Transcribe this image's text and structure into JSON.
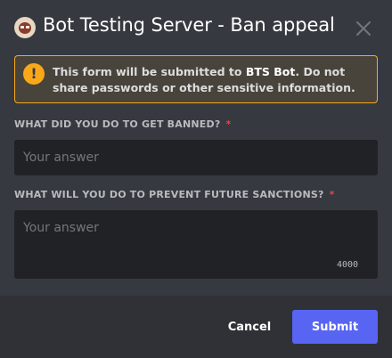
{
  "header": {
    "server_icon": "server-avatar",
    "title": "Bot Testing Server - Ban appeal",
    "close_icon": "close-icon"
  },
  "warning": {
    "icon": "warning-icon",
    "icon_glyph": "!",
    "text_before": "This form will be submitted to ",
    "bot_name": "BTS Bot",
    "text_after": ". Do not share passwords or other sensitive information."
  },
  "questions": [
    {
      "label": "WHAT DID YOU DO TO GET BANNED?",
      "required_mark": "*",
      "placeholder": "Your answer"
    },
    {
      "label": "WHAT WILL YOU DO TO PREVENT FUTURE SANCTIONS?",
      "required_mark": "*",
      "placeholder": "Your answer",
      "char_limit": "4000"
    }
  ],
  "footer": {
    "cancel_label": "Cancel",
    "submit_label": "Submit"
  },
  "colors": {
    "background": "#36393f",
    "footer": "#2f3136",
    "input": "#202225",
    "warning": "#faa81a",
    "required": "#ed4245",
    "brand": "#5865f2"
  }
}
